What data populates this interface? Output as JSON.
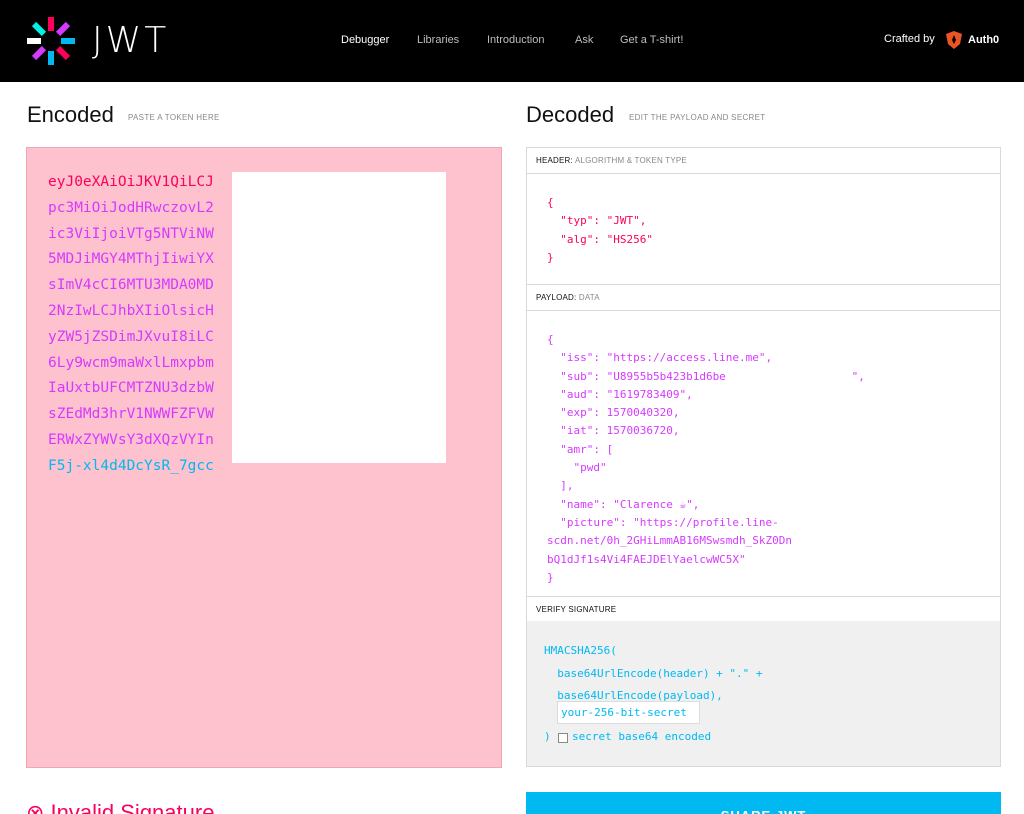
{
  "header": {
    "logo_text": "JWT",
    "nav": [
      {
        "label": "Debugger",
        "active": true
      },
      {
        "label": "Libraries",
        "active": false
      },
      {
        "label": "Introduction",
        "active": false
      },
      {
        "label": "Ask",
        "active": false
      },
      {
        "label": "Get a T-shirt!",
        "active": false
      }
    ],
    "crafted_by": "Crafted by",
    "brand": "Auth0"
  },
  "encoded": {
    "title": "Encoded",
    "subtitle": "PASTE A TOKEN HERE",
    "token_lines": [
      {
        "text": "eyJ0eXAiOiJKV1QiLCJ",
        "color": "#fb015b"
      },
      {
        "text": "pc3MiOiJodHRwczovL2",
        "color": "#d63aff"
      },
      {
        "text": "ic3ViIjoiVTg5NTViNW",
        "color": "#d63aff"
      },
      {
        "text": "5MDJiMGY4MThjIiwiYX",
        "color": "#d63aff"
      },
      {
        "text": "sImV4cCI6MTU3MDA0MD",
        "color": "#d63aff"
      },
      {
        "text": "2NzIwLCJhbXIiOlsicH",
        "color": "#d63aff"
      },
      {
        "text": "yZW5jZSDimJXvuI8iLC",
        "color": "#d63aff"
      },
      {
        "text": "6Ly9wcm9maWxlLmxpbm",
        "color": "#d63aff"
      },
      {
        "text": "IaUxtbUFCMTZNU3dzbW",
        "color": "#d63aff"
      },
      {
        "text": "sZEdMd3hrV1NWWFZFVW",
        "color": "#d63aff"
      },
      {
        "text": "ERWxZYWVsY3dXQzVYIn",
        "color": "#d63aff"
      },
      {
        "text": "F5j-xl4d4DcYsR_7gcc",
        "color": "#00b9f1"
      }
    ]
  },
  "decoded": {
    "title": "Decoded",
    "subtitle": "EDIT THE PAYLOAD AND SECRET",
    "header_label": "HEADER:",
    "header_label_muted": "ALGORITHM & TOKEN TYPE",
    "header_json": [
      "{",
      "  \"typ\": \"JWT\",",
      "  \"alg\": \"HS256\"",
      "}"
    ],
    "payload_label": "PAYLOAD:",
    "payload_label_muted": "DATA",
    "payload_json": [
      "{",
      "  \"iss\": \"https://access.line.me\",",
      "  \"sub\": \"U8955b5b423b1d6be                   \",",
      "  \"aud\": \"1619783409\",",
      "  \"exp\": 1570040320,",
      "  \"iat\": 1570036720,",
      "  \"amr\": [",
      "    \"pwd\"",
      "  ],",
      "  \"name\": \"Clarence ☕\",",
      "  \"picture\": \"https://profile.line-",
      "scdn.net/0h_2GHiLmmAB16MSwsmdh_SkZ0Dn",
      "bQ1dJf1s4Vi4FAEJDElYaelcwWC5X\"",
      "}"
    ],
    "verify_label": "VERIFY SIGNATURE",
    "verify_lines": [
      "HMACSHA256(",
      "  base64UrlEncode(header) + \".\" +",
      "  base64UrlEncode(payload),"
    ],
    "secret_value": "your-256-bit-secret",
    "close_paren": ")",
    "secret_b64_label": "secret base64 encoded"
  },
  "footer": {
    "invalid_label": "⊗ Invalid Signature",
    "share_button": "SHARE JWT"
  }
}
